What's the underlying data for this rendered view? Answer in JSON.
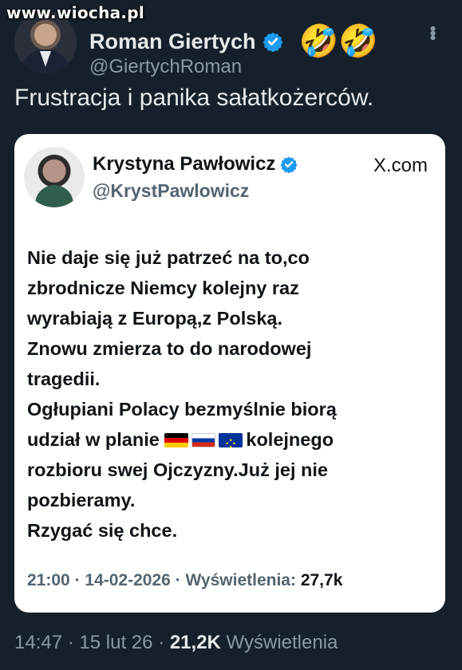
{
  "watermark": "www.wiocha.pl",
  "post": {
    "author_name": "Roman Giertych",
    "author_handle": "@GiertychRoman",
    "emoji": "🤣🤣",
    "text": "Frustracja i panika sałatkożerców.",
    "time": "14:47",
    "date": "15 lut 26",
    "views_count": "21,2K",
    "views_label": "Wyświetlenia"
  },
  "quoted": {
    "author_name": "Krystyna Pawłowicz",
    "author_handle": "@KrystPawlowicz",
    "source": "X.com",
    "lines": [
      "Nie daje się już patrzeć na to,co",
      "zbrodnicze Niemcy kolejny raz",
      "wyrabiają z Europą,z Polską.",
      "Znowu zmierza to do narodowej",
      "tragedii.",
      "Ogłupiani Polacy bezmyślnie biorą",
      "udział w planie",
      "kolejnego",
      "rozbioru swej Ojczyzny.Już jej nie",
      "pozbieramy.",
      "Rzygać się chce."
    ],
    "time": "21:00",
    "date": "14-02-2026",
    "views_label": "Wyświetlenia:",
    "views_count": "27,7k"
  },
  "icons": {
    "verified": "verified-badge-icon",
    "more": "more-options-icon",
    "flags": [
      "germany-flag-icon",
      "russia-flag-icon",
      "eu-flag-icon"
    ]
  },
  "colors": {
    "background": "#15202b",
    "verified_blue": "#1d9bf0",
    "muted": "#8b98a5"
  }
}
